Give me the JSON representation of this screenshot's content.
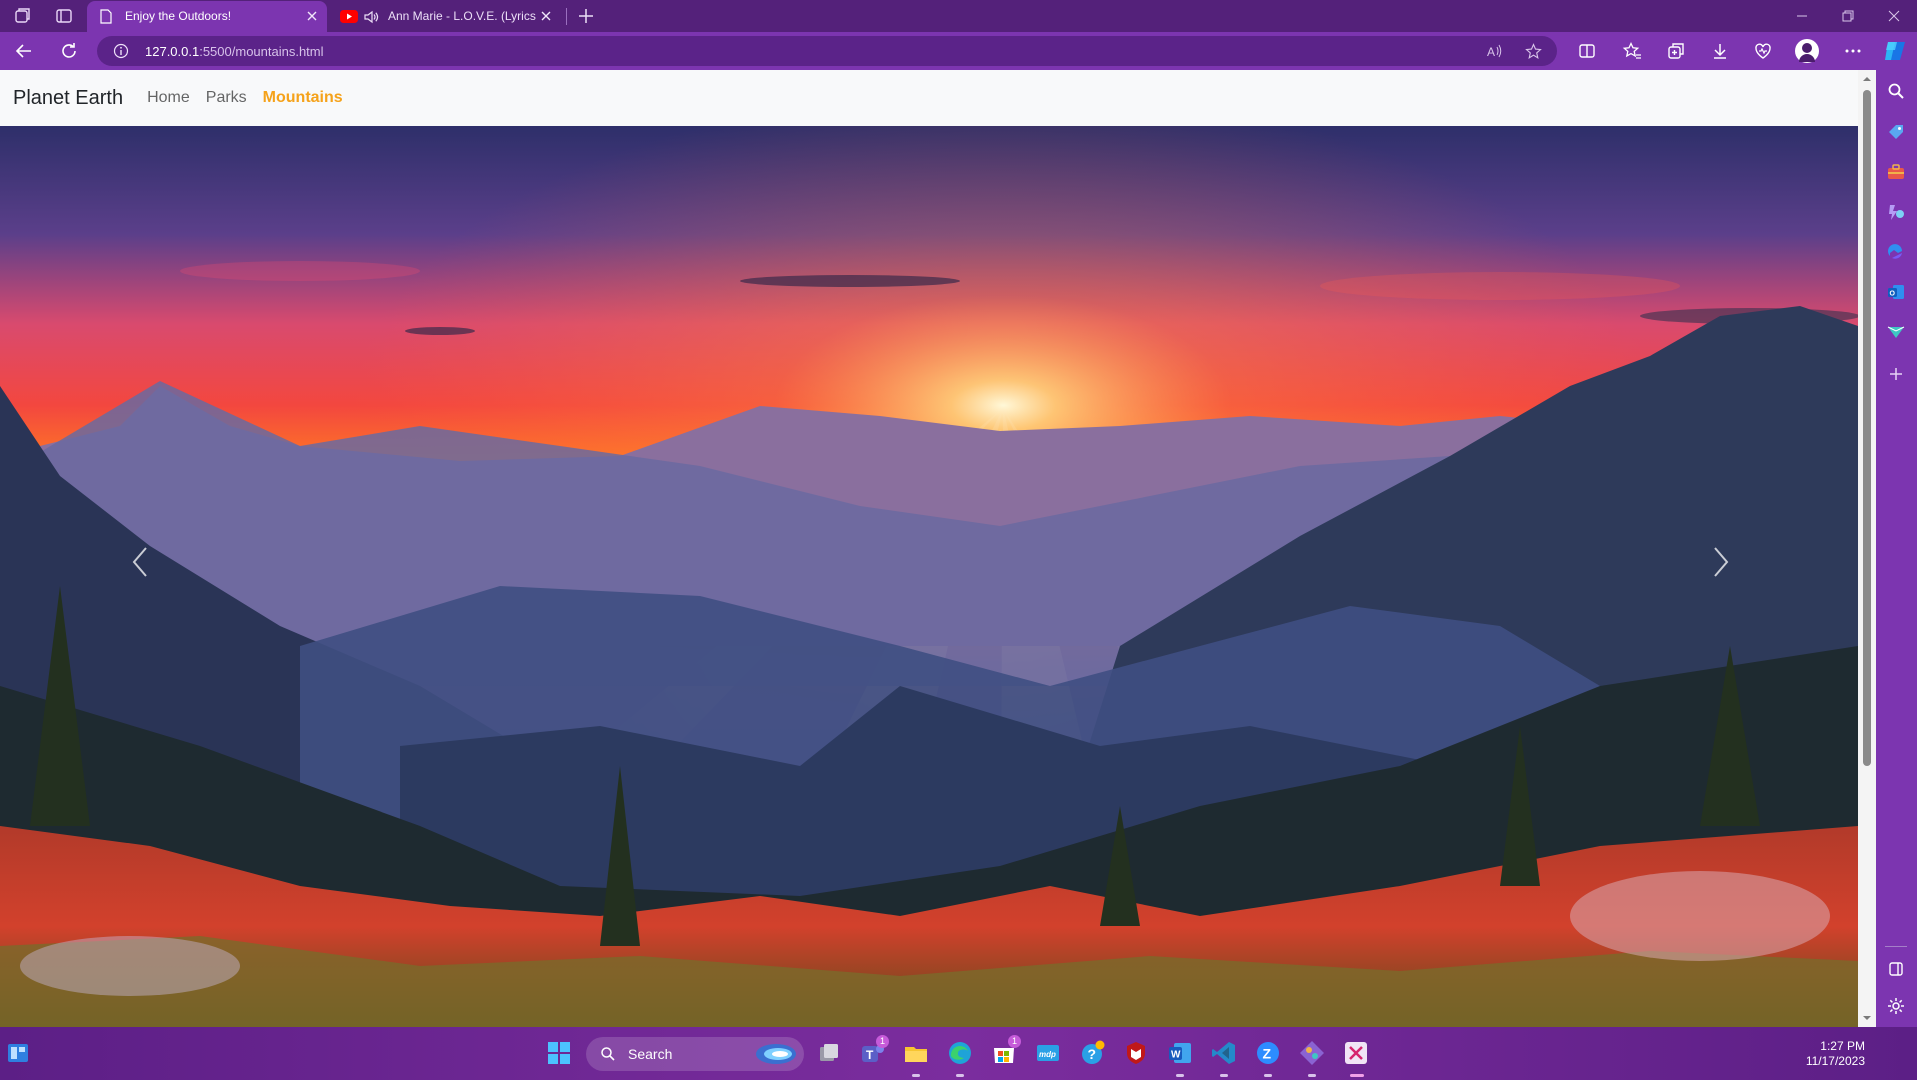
{
  "browser": {
    "tabs": [
      {
        "title": "Enjoy the Outdoors!",
        "active": true
      },
      {
        "title": "Ann Marie - L.O.V.E. (Lyrics)",
        "active": false,
        "audio_playing": true
      }
    ],
    "address": {
      "host": "127.0.0.1",
      "rest": ":5500/mountains.html"
    }
  },
  "page": {
    "brand": "Planet Earth",
    "nav": [
      "Home",
      "Parks",
      "Mountains"
    ],
    "active_nav": "Mountains",
    "hero": {
      "description": "sunset-over-mountain-valley",
      "controls": [
        "prev-arrow",
        "next-arrow"
      ]
    }
  },
  "taskbar": {
    "search_label": "Search",
    "apps": [
      "windows-start",
      "search",
      "task-view",
      "teams",
      "file-explorer",
      "edge",
      "microsoft-store",
      "mcafee-mdp",
      "help-tips",
      "mcafee-shield",
      "word",
      "vs-code",
      "zoom",
      "git-tool",
      "snipping-tool"
    ],
    "badges": {
      "teams": "1",
      "microsoft-store": "1"
    },
    "clock": {
      "time": "1:27 PM",
      "date": "11/17/2023"
    }
  },
  "colors": {
    "chrome_purple": "#7c35b0",
    "active_link": "#f5a21a",
    "taskbar": "#6a2494"
  }
}
